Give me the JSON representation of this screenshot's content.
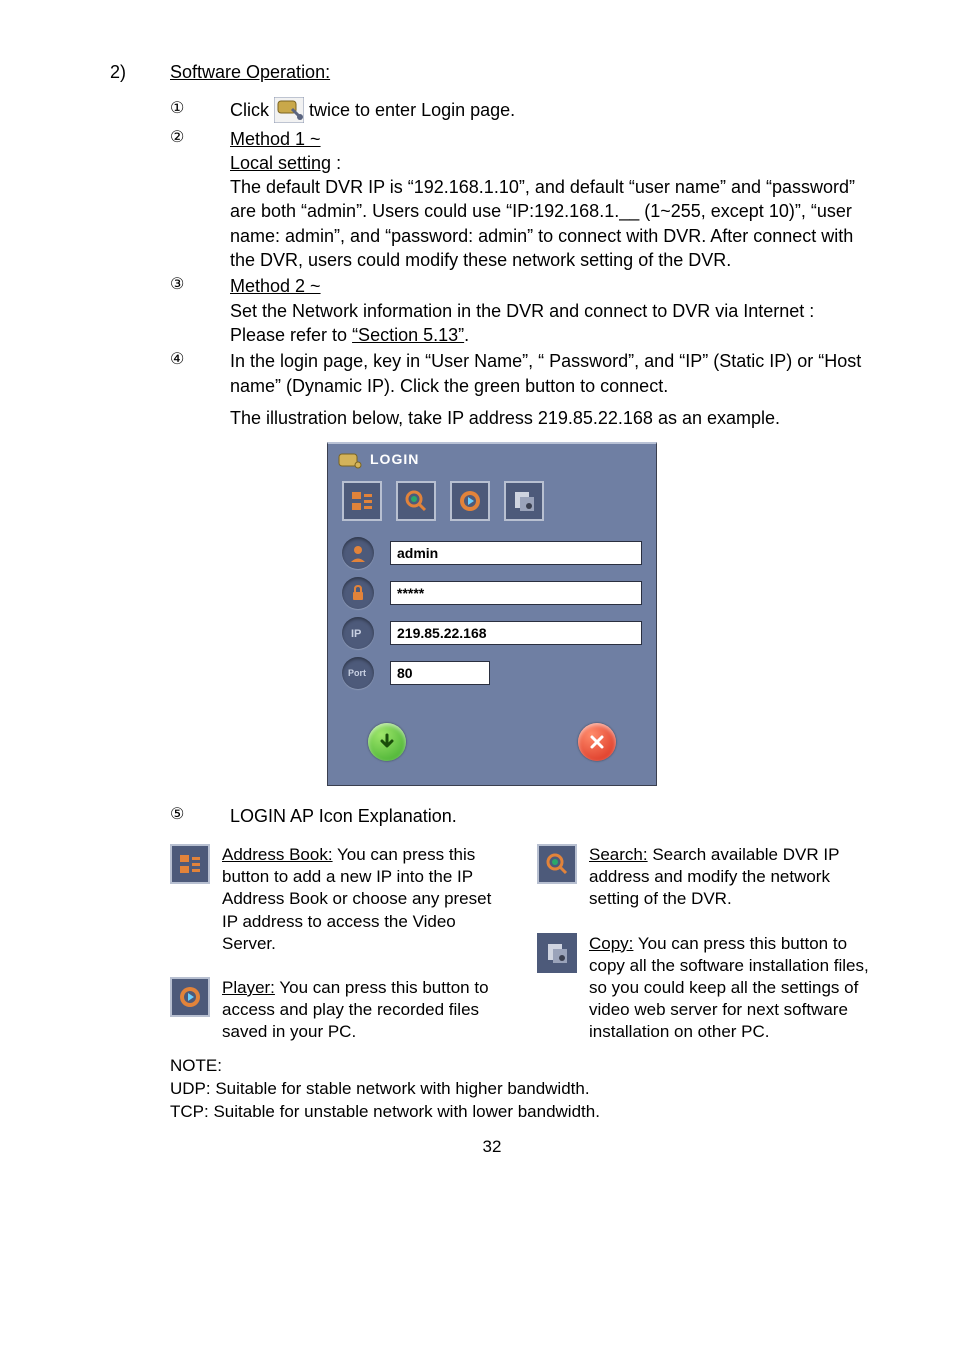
{
  "section": {
    "number": "2)",
    "title": "Software Operation:"
  },
  "markers": {
    "m1": "①",
    "m2": "②",
    "m3": "③",
    "m4": "④",
    "m5": "⑤"
  },
  "step1": {
    "prefix": "Click ",
    "suffix": " twice to enter Login page."
  },
  "step2": {
    "title": "Method 1 ~",
    "subtitle": "Local setting :",
    "body": "The default DVR IP is “192.168.1.10”, and default “user name” and “password” are both “admin”. Users could use “IP:192.168.1.__ (1~255, except 10)”, “user name: admin”, and “password: admin” to connect with DVR. After connect with the DVR, users could modify these network setting of the DVR."
  },
  "step3": {
    "title": "Method 2 ~",
    "line1": "Set the Network information in the DVR and connect to DVR via Internet :",
    "line2_prefix": "Please refer to ",
    "line2_link": "“Section 5.13”",
    "line2_suffix": "."
  },
  "step4": {
    "body": "In the login page, key in “User Name”, “ Password”, and “IP” (Static IP) or “Host name” (Dynamic IP). Click the green button to connect.",
    "illustration": "The illustration below, take IP address 219.85.22.168 as an example."
  },
  "login": {
    "title": "LOGIN",
    "username": "admin",
    "password": "*****",
    "ip": "219.85.22.168",
    "port": "80"
  },
  "step5": {
    "body": "LOGIN AP Icon Explanation."
  },
  "icons": {
    "addressbook": {
      "title": "Address Book:",
      "text": " You can press this button to add a new IP into the IP Address Book or choose any preset IP address to access the Video Server."
    },
    "search": {
      "title": "Search:",
      "text": " Search available DVR IP address and modify the network setting of the DVR."
    },
    "player": {
      "title": "Player:",
      "text": " You can press this button to access and play the recorded files saved in your PC."
    },
    "copy": {
      "title": "Copy:",
      "text": " You can press this button to copy all the software installation files, so you could keep all the settings of video web server for next software installation on other PC."
    }
  },
  "note": {
    "heading": "NOTE:",
    "udp": "UDP: Suitable for stable network with higher bandwidth.",
    "tcp": "TCP: Suitable for unstable network with lower bandwidth."
  },
  "page_number": "32"
}
